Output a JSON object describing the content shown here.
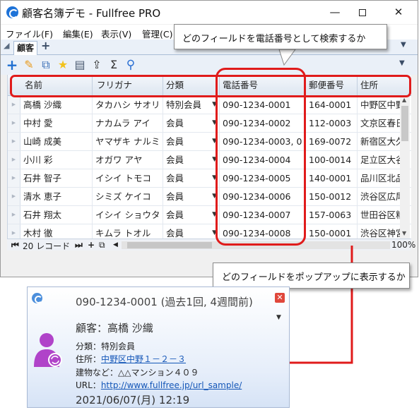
{
  "window": {
    "title": "顧客名簿デモ - Fullfree PRO",
    "controls": {
      "minimize": "—",
      "maximize": "",
      "close": "✕"
    }
  },
  "menubar": [
    {
      "label": "ファイル(F)"
    },
    {
      "label": "編集(E)"
    },
    {
      "label": "表示(V)"
    },
    {
      "label": "管理(C)"
    }
  ],
  "tabs": {
    "active": "顧客",
    "add": "+",
    "menu": "▼"
  },
  "toolbar": {
    "icons": [
      "add-icon",
      "edit-pencil-icon",
      "copy-record-icon",
      "favorite-star-icon",
      "calendar-report-icon",
      "export-icon",
      "sum-icon",
      "search-icon"
    ],
    "colors": {
      "add": "#1f6fd1",
      "edit": "#e89a1c",
      "star": "#f2c21b",
      "search": "#2a6fd3"
    }
  },
  "grid": {
    "columns": [
      "名前",
      "フリガナ",
      "分類",
      "電話番号",
      "郵便番号",
      "住所"
    ],
    "rows": [
      {
        "name": "高橋 沙織",
        "kana": "タカハシ サオリ",
        "category": "特別会員",
        "phone": "090-1234-0001",
        "zip": "164-0001",
        "address": "中野区中野"
      },
      {
        "name": "中村 愛",
        "kana": "ナカムラ アイ",
        "category": "会員",
        "phone": "090-1234-0002",
        "zip": "112-0003",
        "address": "文京区春日"
      },
      {
        "name": "山崎 成美",
        "kana": "ヤマザキ ナルミ",
        "category": "会員",
        "phone": "090-1234-0003, 0",
        "zip": "169-0072",
        "address": "新宿区大久"
      },
      {
        "name": "小川 彩",
        "kana": "オガワ アヤ",
        "category": "会員",
        "phone": "090-1234-0004",
        "zip": "100-0014",
        "address": "足立区大谷"
      },
      {
        "name": "石井 智子",
        "kana": "イシイ トモコ",
        "category": "会員",
        "phone": "090-1234-0005",
        "zip": "140-0001",
        "address": "品川区北品"
      },
      {
        "name": "清水 恵子",
        "kana": "シミズ ケイコ",
        "category": "会員",
        "phone": "090-1234-0006",
        "zip": "150-0012",
        "address": "渋谷区広尾"
      },
      {
        "name": "石井 翔太",
        "kana": "イシイ ショウタ",
        "category": "会員",
        "phone": "090-1234-0007",
        "zip": "157-0063",
        "address": "世田谷区粕"
      },
      {
        "name": "木村 徹",
        "kana": "キムラ トオル",
        "category": "会員",
        "phone": "090-1234-0008",
        "zip": "150-0001",
        "address": "渋谷区神宮"
      }
    ]
  },
  "statusbar": {
    "record_count": "20 レコード",
    "zoom": "100%"
  },
  "callouts": {
    "phone_field": "どのフィールドを電話番号として検索するか",
    "popup_fields": "どのフィールドをポップアップに表示するか",
    "color": "#e01b1b"
  },
  "popup": {
    "title": "090-1234-0001 (過去1回, 4週間前)",
    "customer": "顧客：高橋 沙織",
    "category": "分類：特別会員",
    "address_label": "住所：",
    "address_link": "中野区中野１－２－３",
    "building": "建物など：△△マンション４０９",
    "url_label": "URL：",
    "url_link": "http://www.fullfree.jp/url_sample/",
    "datetime": "2021/06/07(月) 12:19",
    "avatar_color": "#b043c9"
  }
}
